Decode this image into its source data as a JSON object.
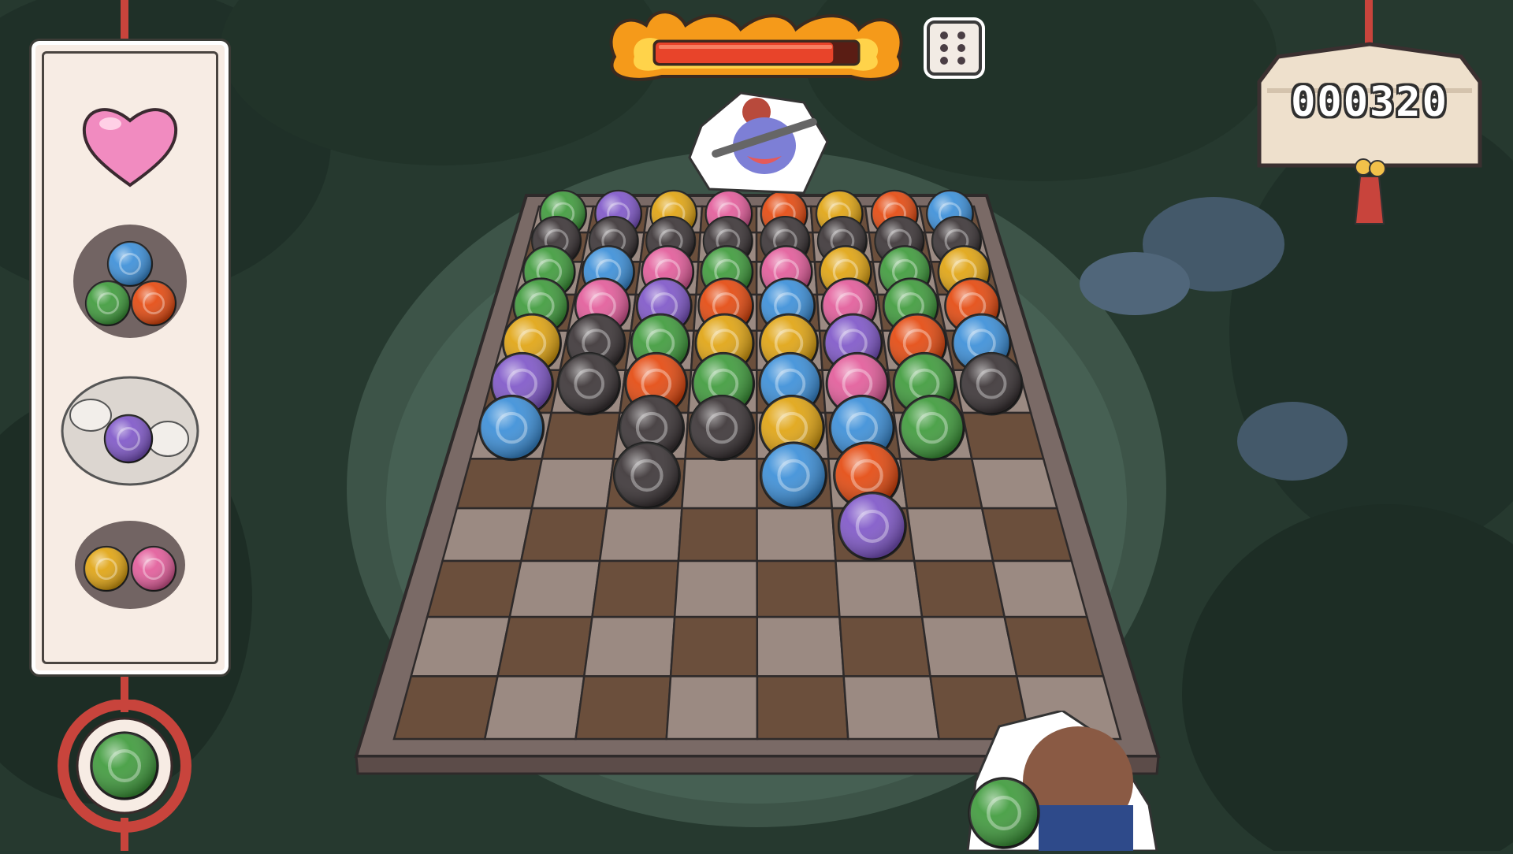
{
  "score": {
    "value": "000320"
  },
  "health_bar": {
    "level": 0.88,
    "fill_color": "#e8442a"
  },
  "dice": {
    "face": 6
  },
  "colors": {
    "green": "#3f9b3c",
    "purple": "#7f57c8",
    "gold": "#e0a412",
    "pink": "#e25c9a",
    "orange": "#e4490f",
    "blue": "#3c8fd8",
    "black": "#3b3436"
  },
  "side_panel": {
    "slots": [
      {
        "icon": "pink-heart-icon"
      },
      {
        "icon": "triple-orb-combo-icon",
        "orbs": [
          "blue",
          "green",
          "orange"
        ]
      },
      {
        "icon": "spirit-beasts-purple-orb-icon",
        "orbs": [
          "purple"
        ]
      },
      {
        "icon": "double-orb-combo-icon",
        "orbs": [
          "gold",
          "pink"
        ]
      }
    ],
    "next_orb": {
      "icon": "next-orb-green-icon",
      "color": "green"
    }
  },
  "board": {
    "columns": 8,
    "rows": 12,
    "orbs_by_column": [
      [
        "green",
        "black",
        "green",
        "green",
        "gold",
        "purple",
        "blue"
      ],
      [
        "purple",
        "black",
        "blue",
        "pink",
        "black",
        "black"
      ],
      [
        "gold",
        "black",
        "pink",
        "purple",
        "green",
        "orange",
        "black",
        "black"
      ],
      [
        "pink",
        "black",
        "green",
        "orange",
        "gold",
        "green",
        "black"
      ],
      [
        "orange",
        "black",
        "pink",
        "blue",
        "gold",
        "blue",
        "gold",
        "blue"
      ],
      [
        "gold",
        "black",
        "gold",
        "pink",
        "purple",
        "pink",
        "blue",
        "orange",
        "purple"
      ],
      [
        "orange",
        "black",
        "green",
        "green",
        "orange",
        "green",
        "green"
      ],
      [
        "blue",
        "black",
        "gold",
        "orange",
        "blue",
        "black"
      ]
    ]
  },
  "characters": {
    "enemy": {
      "icon": "oni-demon-with-club-icon"
    },
    "player": {
      "icon": "girl-holding-orb-icon",
      "orb": "green"
    }
  }
}
